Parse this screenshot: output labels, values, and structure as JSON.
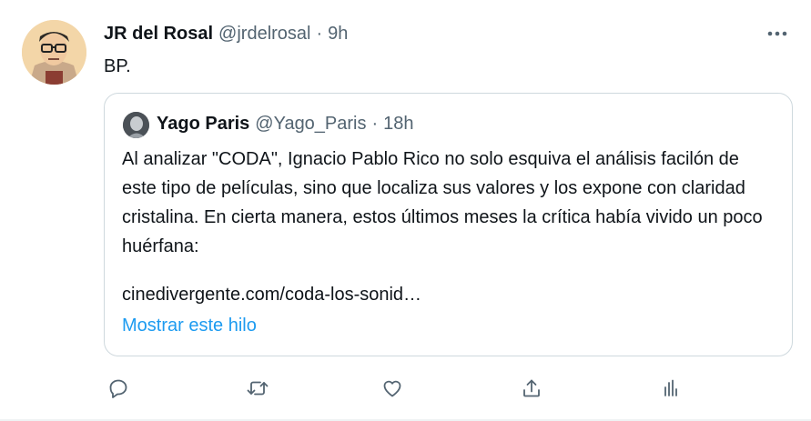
{
  "tweet": {
    "author_name": "JR del Rosal",
    "author_handle": "@jrdelrosal",
    "separator": "·",
    "time": "9h",
    "text": "BP."
  },
  "quote": {
    "author_name": "Yago Paris",
    "author_handle": "@Yago_Paris",
    "separator": "·",
    "time": "18h",
    "body": "Al analizar \"CODA\", Ignacio Pablo Rico no solo esquiva el análisis facilón de este tipo de películas, sino que localiza sus valores y los expone con claridad cristalina. En cierta manera, estos últimos meses la crítica había vivido un poco huérfana:",
    "link": "cinedivergente.com/coda-los-sonid…",
    "show_thread": "Mostrar este hilo"
  },
  "actions": [
    "reply-icon",
    "retweet-icon",
    "like-icon",
    "share-icon",
    "analytics-icon"
  ],
  "colors": {
    "accent": "#1d9bf0",
    "secondary_text": "#536471",
    "border": "#cfd9de"
  }
}
